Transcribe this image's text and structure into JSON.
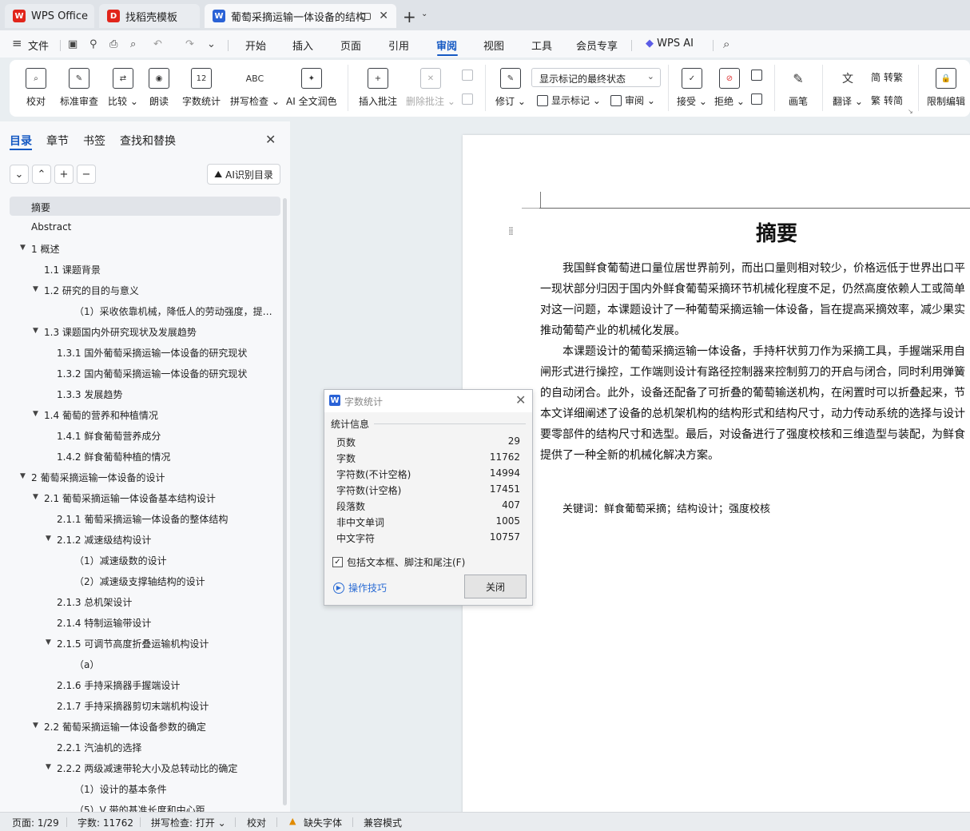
{
  "tabs": [
    {
      "label": "WPS Office",
      "icon": "wps-logo-icon",
      "color": "#e1251b"
    },
    {
      "label": "找稻壳模板",
      "icon": "docer-logo-icon",
      "color": "#e1251b"
    },
    {
      "label": "葡萄采摘运输一体设备的结构",
      "icon": "word-doc-icon",
      "color": "#2a62d6"
    }
  ],
  "menu": {
    "file": "文件",
    "items": [
      "开始",
      "插入",
      "页面",
      "引用",
      "审阅",
      "视图",
      "工具",
      "会员专享"
    ],
    "active": "审阅",
    "wps_ai": "WPS AI"
  },
  "ribbon": {
    "proofread": "校对",
    "standard_review": "标准审查",
    "compare": "比较",
    "read_aloud": "朗读",
    "word_count": "字数统计",
    "spell_check": "拼写检查",
    "ai_polish": "AI 全文润色",
    "insert_comment": "插入批注",
    "delete_comment": "删除批注",
    "markup_select": "显示标记的最终状态",
    "track_changes": "修订",
    "show_markup": "显示标记",
    "review_pane": "审阅",
    "accept": "接受",
    "reject": "拒绝",
    "pen": "画笔",
    "translate": "翻译",
    "to_traditional": "转繁",
    "to_simplified": "转简",
    "restrict_edit": "限制编辑",
    "word_count_icon_text": "12",
    "spell_icon_text": "ABC"
  },
  "nav": {
    "tabs": [
      "目录",
      "章节",
      "书签",
      "查找和替换"
    ],
    "ai_toc": "AI识别目录",
    "toc": [
      {
        "label": "摘要",
        "level": 0,
        "arrow": false,
        "selected": true
      },
      {
        "label": "Abstract",
        "level": 0,
        "arrow": false
      },
      {
        "label": "1  概述",
        "level": 0,
        "arrow": true
      },
      {
        "label": "1.1 课题背景",
        "level": 1,
        "arrow": false
      },
      {
        "label": "1.2 研究的目的与意义",
        "level": 1,
        "arrow": true
      },
      {
        "label": "（1）采收依靠机械，降低人的劳动强度，提高生 ...",
        "level": 3,
        "arrow": false
      },
      {
        "label": "1.3 课题国内外研究现状及发展趋势",
        "level": 1,
        "arrow": true
      },
      {
        "label": "1.3.1 国外葡萄采摘运输一体设备的研究现状",
        "level": 2,
        "arrow": false
      },
      {
        "label": "1.3.2 国内葡萄采摘运输一体设备的研究现状",
        "level": 2,
        "arrow": false
      },
      {
        "label": "1.3.3 发展趋势",
        "level": 2,
        "arrow": false
      },
      {
        "label": "1.4 葡萄的营养和种植情况",
        "level": 1,
        "arrow": true
      },
      {
        "label": "1.4.1 鲜食葡萄营养成分",
        "level": 2,
        "arrow": false
      },
      {
        "label": "1.4.2 鲜食葡萄种植的情况",
        "level": 2,
        "arrow": false
      },
      {
        "label": "2  葡萄采摘运输一体设备的设计",
        "level": 0,
        "arrow": true
      },
      {
        "label": "2.1 葡萄采摘运输一体设备基本结构设计",
        "level": 1,
        "arrow": true
      },
      {
        "label": "2.1.1 葡萄采摘运输一体设备的整体结构",
        "level": 2,
        "arrow": false
      },
      {
        "label": "2.1.2 减速级结构设计",
        "level": 2,
        "arrow": true
      },
      {
        "label": "（1）减速级数的设计",
        "level": 3,
        "arrow": false
      },
      {
        "label": "（2）减速级支撑轴结构的设计",
        "level": 3,
        "arrow": false
      },
      {
        "label": "2.1.3 总机架设计",
        "level": 2,
        "arrow": false
      },
      {
        "label": "2.1.4 特制运输带设计",
        "level": 2,
        "arrow": false
      },
      {
        "label": "2.1.5 可调节高度折叠运输机构设计",
        "level": 2,
        "arrow": true
      },
      {
        "label": "（a）",
        "level": 3,
        "arrow": false
      },
      {
        "label": "2.1.6 手持采摘器手握端设计",
        "level": 2,
        "arrow": false
      },
      {
        "label": "2.1.7 手持采摘器剪切末端机构设计",
        "level": 2,
        "arrow": false
      },
      {
        "label": "2.2 葡萄采摘运输一体设备参数的确定",
        "level": 1,
        "arrow": true
      },
      {
        "label": "2.2.1 汽油机的选择",
        "level": 2,
        "arrow": false
      },
      {
        "label": "2.2.2 两级减速带轮大小及总转动比的确定",
        "level": 2,
        "arrow": true
      },
      {
        "label": "（1）设计的基本条件",
        "level": 3,
        "arrow": false
      },
      {
        "label": "（5）V 带的基准长度和中心距",
        "level": 3,
        "arrow": false
      }
    ]
  },
  "document": {
    "title": "摘要",
    "paragraphs": [
      [
        "我国鲜食葡萄进口量位居世界前列，而出口量则相对较少，价格远低于世界出口平",
        "一现状部分归因于国内外鲜食葡萄采摘环节机械化程度不足，仍然高度依赖人工或简单",
        "对这一问题，本课题设计了一种葡萄采摘运输一体设备，旨在提高采摘效率，减少果实",
        "推动葡萄产业的机械化发展。"
      ],
      [
        "本课题设计的葡萄采摘运输一体设备，手持杆状剪刀作为采摘工具，手握端采用自",
        "闸形式进行操控，工作端则设计有路径控制器来控制剪刀的开启与闭合，同时利用弹簧",
        "的自动闭合。此外，设备还配备了可折叠的葡萄输送机构，在闲置时可以折叠起来，节",
        "本文详细阐述了设备的总机架机构的结构形式和结构尺寸，动力传动系统的选择与设计",
        "要零部件的结构尺寸和选型。最后，对设备进行了强度校核和三维造型与装配，为鲜食",
        "提供了一种全新的机械化解决方案。"
      ]
    ],
    "keywords": "关键词：鲜食葡萄采摘；结构设计；强度校核"
  },
  "dialog": {
    "title": "字数统计",
    "section": "统计信息",
    "stats": [
      {
        "label": "页数",
        "value": "29"
      },
      {
        "label": "字数",
        "value": "11762"
      },
      {
        "label": "字符数(不计空格)",
        "value": "14994"
      },
      {
        "label": "字符数(计空格)",
        "value": "17451"
      },
      {
        "label": "段落数",
        "value": "407"
      },
      {
        "label": "非中文单词",
        "value": "1005"
      },
      {
        "label": "中文字符",
        "value": "10757"
      }
    ],
    "checkbox_label": "包括文本框、脚注和尾注(F)",
    "checkbox_checked": true,
    "tips": "操作技巧",
    "close": "关闭"
  },
  "status": {
    "page": "页面: 1/29",
    "words": "字数: 11762",
    "spell": "拼写检查: 打开",
    "proof": "校对",
    "missing_font": "缺失字体",
    "compat": "兼容模式"
  },
  "colors": {
    "accent": "#1559c3",
    "wps_red": "#e1251b",
    "word_blue": "#2a62d6",
    "warning": "#e08a00"
  }
}
